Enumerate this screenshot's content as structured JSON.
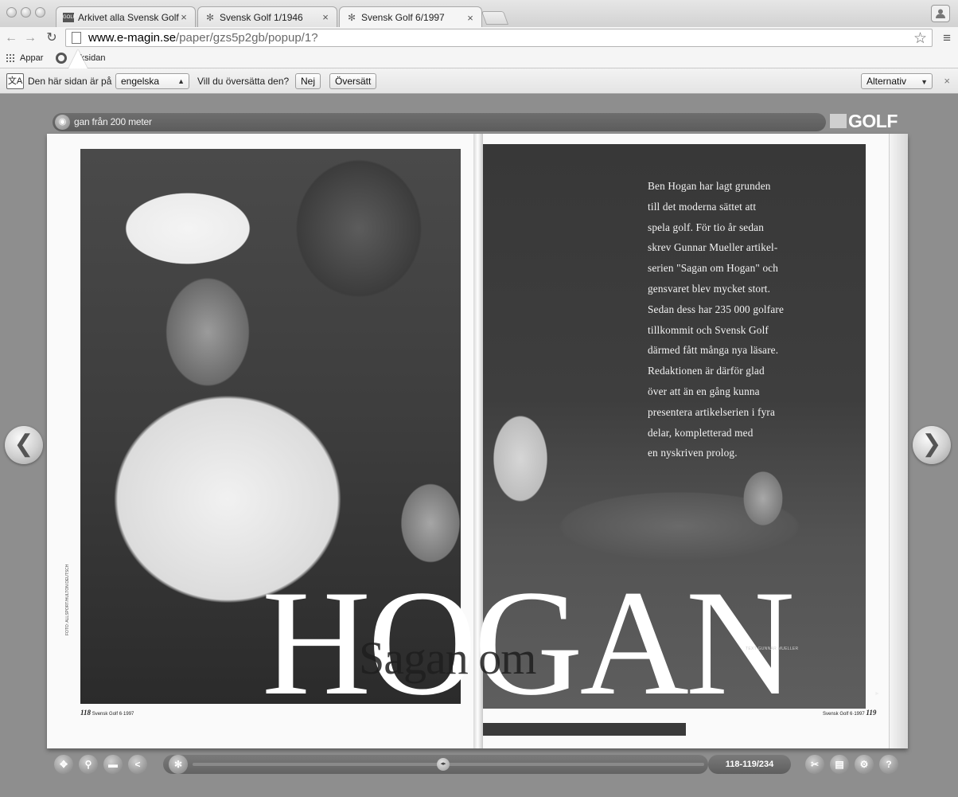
{
  "browser": {
    "tabs": [
      {
        "label": "Arkivet alla Svensk Golf – E",
        "favicon": "golf-favicon",
        "active": false
      },
      {
        "label": "Svensk Golf 1/1946",
        "favicon": "gear-favicon",
        "active": false
      },
      {
        "label": "Svensk Golf 6/1997",
        "favicon": "gear-favicon",
        "active": true
      }
    ],
    "tab_close_glyph": "×",
    "url_host": "www.e-magin.se",
    "url_path": "/paper/gzs5p2gb/popup/1?",
    "bookmarks": {
      "apps_label": "Appar",
      "start_label": "rksidan"
    },
    "icons": [
      "back-icon",
      "forward-icon",
      "reload-icon",
      "page-icon",
      "bookmark-star-icon",
      "menu-icon",
      "profile-icon"
    ]
  },
  "translate_bar": {
    "prefix": "Den här sidan är på",
    "language": "engelska",
    "question": "Vill du översätta den?",
    "no_label": "Nej",
    "translate_label": "Översätt",
    "options_label": "Alternativ",
    "close_glyph": "×"
  },
  "reader": {
    "headline": "gan från 200 meter",
    "magazine_logo": "GOLF",
    "intro_lines": [
      "Ben Hogan har lagt grunden",
      "till det moderna sättet att",
      "spela golf. För tio år sedan",
      "skrev Gunnar Mueller artikel-",
      "serien \"Sagan om Hogan\" och",
      "gensvaret blev mycket stort.",
      "Sedan dess har 235 000 golfare",
      "tillkommit och Svensk Golf",
      "därmed fått många nya läsare.",
      "Redaktionen är därför glad",
      "över att än en gång kunna",
      "presentera artikelserien i fyra",
      "delar, kompletterad med",
      "en nyskriven prolog."
    ],
    "big_title": "HOGAN",
    "overlay_title": "Sagan om",
    "byline": "TEXT GUNNAR MUELLER",
    "photo_credit": "FOTO: ALLSPORT/HULTON DEUTSCH",
    "folio_left_number": "118",
    "folio_left_text": "Svensk Golf 6·1997",
    "folio_right_text": "Svensk Golf 6·1997",
    "folio_right_number": "119",
    "prev_glyph": "❮",
    "next_glyph": "❯",
    "page_indicator": "118-119/234",
    "slider_position": 0.49,
    "controls": [
      "move-icon",
      "zoom-icon",
      "folder-icon",
      "share-icon",
      "thumbnails-icon",
      "cut-icon",
      "print-icon",
      "settings-icon",
      "help-icon"
    ]
  }
}
